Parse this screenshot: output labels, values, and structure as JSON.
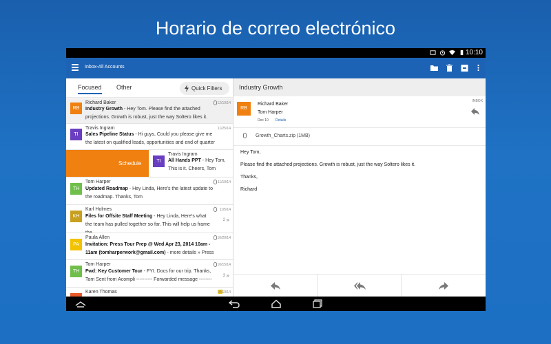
{
  "headline": "Horario de correo electrónico",
  "status_bar": {
    "time": "10:10"
  },
  "app_bar": {
    "account": "Inbox-All Accounts",
    "actions": [
      "folder-icon",
      "trash-icon",
      "archive-icon",
      "more-vert-icon"
    ]
  },
  "tabs": {
    "focused": "Focused",
    "other": "Other",
    "quick_filters": "Quick Filters"
  },
  "messages": [
    {
      "initials": "RB",
      "color": "#f08010",
      "sender": "Richard Baker",
      "date": "12/10/14",
      "subject": "Industry Growth",
      "preview": " - Hey Tom. Please find the attached projections. Growth is robust, just the way Soltero likes it.",
      "attachment": true
    },
    {
      "initials": "TI",
      "color": "#6a3ec1",
      "sender": "Travis Ingram",
      "date": "11/25/14",
      "subject": "Sales Pipeline Status",
      "preview": " - Hi guys, Could you please give me the latest on qualified leads, opportunities and end of quarter"
    },
    {
      "initials": "TI",
      "color": "#6a3ec1",
      "sender": "Travis Ingram",
      "subject": "All Hands PPT",
      "preview": " - Hey Tom, This is it. Cheers, Tom",
      "swipe_label": "Schedule"
    },
    {
      "initials": "TH",
      "color": "#6fbf4a",
      "sender": "Tom Harper",
      "date": "11/10/14",
      "subject": "Updated Roadmap",
      "preview": " - Hey Linda, Here's the latest update to the roadmap. Thanks, Tom",
      "attachment": true
    },
    {
      "initials": "KH",
      "color": "#c8a020",
      "sender": "Karl Holmes",
      "date": "11/5/14",
      "subject": "Files for Offsite Staff Meeting",
      "preview": " - Hey Linda, Here's what the team has pulled together so far. This will help us frame the",
      "attachment": true,
      "count": "2"
    },
    {
      "initials": "PA",
      "color": "#f2c200",
      "sender": "Paula Allen",
      "date": "10/20/14",
      "subject": "Invitation: Press Tour Prep @ Wed Apr 23, 2014 10am - 11am (tomharperwork@gmail.com)",
      "preview": " - more details » Press",
      "attachment": true
    },
    {
      "initials": "TH",
      "color": "#6fbf4a",
      "sender": "Tom Harper",
      "date": "10/15/14",
      "subject": "Fwd: Key Customer Tour",
      "preview": " - FYI. Docs for our trip. Thanks, Tom Sent from Acompli ---------- Forwarded message ----------",
      "attachment": true,
      "count": "3"
    },
    {
      "initials": "KT",
      "color": "#e85a2a",
      "sender": "Karen Thomas",
      "date": "10/10/14",
      "flagged": true
    }
  ],
  "reading": {
    "subject": "Industry Growth",
    "initials": "RB",
    "avatar_color": "#f08010",
    "from": "Richard Baker",
    "to": "Tom Harper",
    "date": "Dec 10",
    "details_link": "Details",
    "folder_label": "INBOX",
    "attachment": "Growth_Charts.zip (1MB)",
    "body": [
      "Hey Tom,",
      "Please find the attached projections. Growth is robust, just the way Soltero likes it.",
      "Thanks,",
      "Richard"
    ],
    "actions": [
      "reply-icon",
      "reply-all-icon",
      "forward-icon"
    ]
  },
  "colors": {
    "brand": "#1d63b5",
    "schedule": "#f08010",
    "background": "#1c6fc3"
  }
}
